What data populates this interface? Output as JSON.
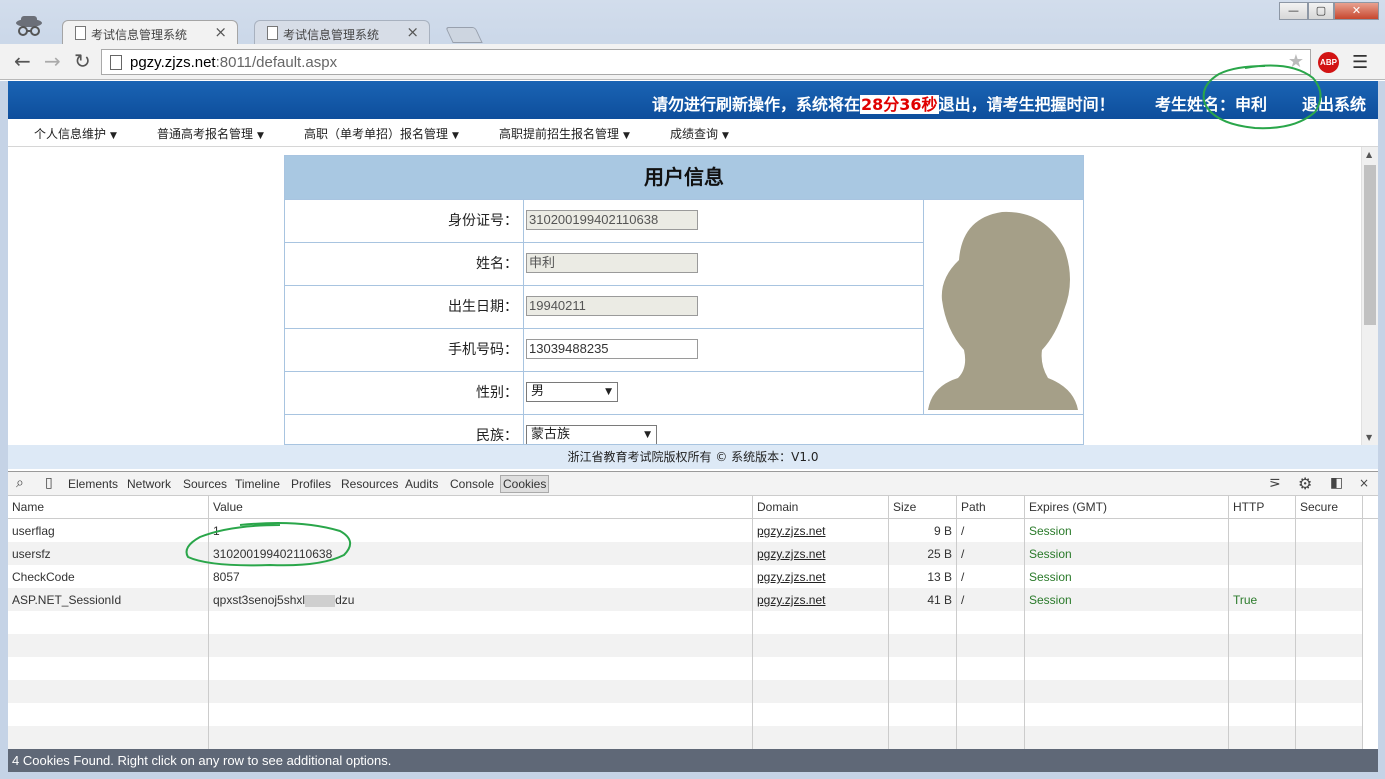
{
  "browser": {
    "tabs": [
      {
        "title": "考试信息管理系统",
        "active": true
      },
      {
        "title": "考试信息管理系统",
        "active": false
      }
    ],
    "url_host": "pgzy.zjzs.net",
    "url_rest": ":8011/default.aspx",
    "abp_label": "ABP",
    "window_buttons": {
      "minimize": "—",
      "maximize": "▢",
      "close": "✕"
    }
  },
  "header": {
    "notice_prefix": "请勿进行刷新操作，系统将在",
    "timer": "28分36秒",
    "notice_suffix": "退出，请考生把握时间！",
    "student_label": "考生姓名：申利",
    "logout": "退出系统",
    "background": "#1a64b4"
  },
  "nav": {
    "items": [
      "个人信息维护",
      "普通高考报名管理",
      "高职（单考单招）报名管理",
      "高职提前招生报名管理",
      "成绩查询"
    ]
  },
  "form": {
    "title": "用户信息",
    "fields": [
      {
        "label": "身份证号：",
        "value": "310200199402110638",
        "readonly": true
      },
      {
        "label": "姓名：",
        "value": "申利",
        "readonly": true
      },
      {
        "label": "出生日期：",
        "value": "19940211",
        "readonly": true
      },
      {
        "label": "手机号码：",
        "value": "13039488235",
        "readonly": false
      },
      {
        "label": "性别：",
        "value": "男",
        "type": "select"
      },
      {
        "label": "民族：",
        "value": "蒙古族",
        "type": "select"
      }
    ]
  },
  "footer": {
    "text": "浙江省教育考试院版权所有 ©    系统版本：V1.0"
  },
  "devtools": {
    "tabs": [
      "Elements",
      "Network",
      "Sources",
      "Timeline",
      "Profiles",
      "Resources",
      "Audits",
      "Console",
      "Cookies"
    ],
    "selected_tab": "Cookies",
    "columns": [
      "Name",
      "Value",
      "Domain",
      "Size",
      "Path",
      "Expires (GMT)",
      "HTTP",
      "Secure"
    ],
    "rows": [
      {
        "name": "userflag",
        "value": "1",
        "domain": "pgzy.zjzs.net",
        "size": "9 B",
        "path": "/",
        "expires": "Session",
        "http": "",
        "secure": ""
      },
      {
        "name": "usersfz",
        "value": "310200199402110638",
        "domain": "pgzy.zjzs.net",
        "size": "25 B",
        "path": "/",
        "expires": "Session",
        "http": "",
        "secure": ""
      },
      {
        "name": "CheckCode",
        "value": "8057",
        "domain": "pgzy.zjzs.net",
        "size": "13 B",
        "path": "/",
        "expires": "Session",
        "http": "",
        "secure": ""
      },
      {
        "name": "ASP.NET_SessionId",
        "value_start": "qpxst3senoj5shxl",
        "value_end": "dzu",
        "domain": "pgzy.zjzs.net",
        "size": "41 B",
        "path": "/",
        "expires": "Session",
        "http": "True",
        "secure": ""
      }
    ],
    "status": "4 Cookies Found. Right click on any row to see additional options."
  }
}
